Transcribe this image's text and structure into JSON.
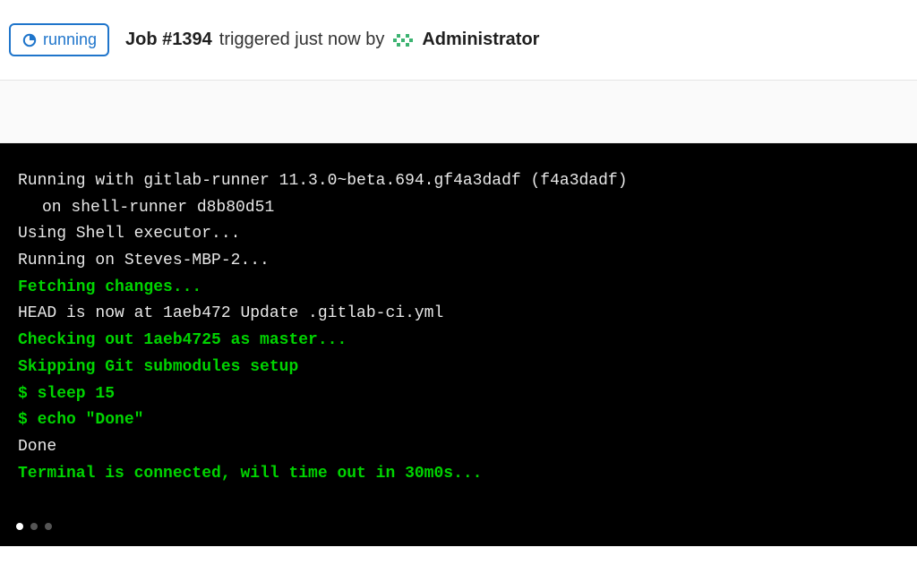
{
  "header": {
    "status": "running",
    "job_label": "Job #1394",
    "triggered_text": "triggered just now by",
    "user_name": "Administrator"
  },
  "terminal": {
    "lines": [
      {
        "text": "Running with gitlab-runner 11.3.0~beta.694.gf4a3dadf (f4a3dadf)",
        "cls": ""
      },
      {
        "text": "on shell-runner d8b80d51",
        "cls": "indent"
      },
      {
        "text": "Using Shell executor...",
        "cls": ""
      },
      {
        "text": "Running on Steves-MBP-2...",
        "cls": ""
      },
      {
        "text": "Fetching changes...",
        "cls": "green"
      },
      {
        "text": "HEAD is now at 1aeb472 Update .gitlab-ci.yml",
        "cls": ""
      },
      {
        "text": "Checking out 1aeb4725 as master...",
        "cls": "green"
      },
      {
        "text": "Skipping Git submodules setup",
        "cls": "green"
      },
      {
        "text": "$ sleep 15",
        "cls": "green"
      },
      {
        "text": "$ echo \"Done\"",
        "cls": "green"
      },
      {
        "text": "Done",
        "cls": ""
      },
      {
        "text": "Terminal is connected, will time out in 30m0s...",
        "cls": "green"
      }
    ]
  }
}
